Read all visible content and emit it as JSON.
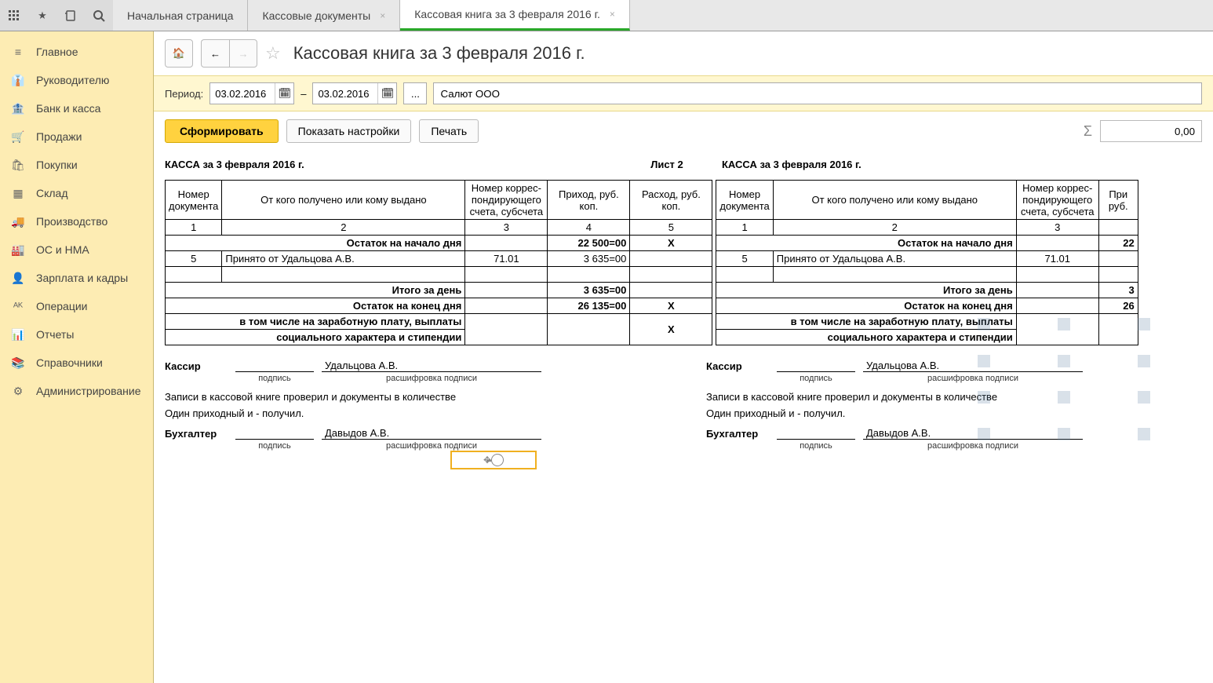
{
  "top": {
    "tabs": [
      {
        "label": "Начальная страница",
        "closable": false,
        "active": false
      },
      {
        "label": "Кассовые документы",
        "closable": true,
        "active": false
      },
      {
        "label": "Кассовая книга за 3 февраля 2016 г.",
        "closable": true,
        "active": true
      }
    ]
  },
  "sidebar": [
    {
      "icon": "menu",
      "label": "Главное"
    },
    {
      "icon": "user-tie",
      "label": "Руководителю"
    },
    {
      "icon": "bank",
      "label": "Банк и касса"
    },
    {
      "icon": "cart",
      "label": "Продажи"
    },
    {
      "icon": "bag",
      "label": "Покупки"
    },
    {
      "icon": "grid",
      "label": "Склад"
    },
    {
      "icon": "truck",
      "label": "Производство"
    },
    {
      "icon": "box",
      "label": "ОС и НМА"
    },
    {
      "icon": "person",
      "label": "Зарплата и кадры"
    },
    {
      "icon": "ops",
      "label": "Операции"
    },
    {
      "icon": "chart",
      "label": "Отчеты"
    },
    {
      "icon": "book",
      "label": "Справочники"
    },
    {
      "icon": "gear",
      "label": "Администрирование"
    }
  ],
  "header": {
    "title": "Кассовая книга за 3 февраля 2016 г."
  },
  "params": {
    "period_label": "Период:",
    "date_from": "03.02.2016",
    "date_sep": "–",
    "date_to": "03.02.2016",
    "dots": "...",
    "org": "Салют ООО"
  },
  "actions": {
    "generate": "Сформировать",
    "settings": "Показать настройки",
    "print": "Печать",
    "sum": "0,00"
  },
  "report": {
    "left_caption": "КАССА за 3 февраля 2016 г.",
    "sheet": "Лист 2",
    "right_caption": "КАССА за 3 февраля 2016 г.",
    "cols": {
      "c1": "Номер документа",
      "c2": "От кого получено или кому выдано",
      "c3": "Номер коррес-пондирующего счета, субсчета",
      "c4": "Приход, руб. коп.",
      "c5": "Расход, руб. коп.",
      "c4p": "При руб."
    },
    "nums": {
      "n1": "1",
      "n2": "2",
      "n3": "3",
      "n4": "4",
      "n5": "5"
    },
    "rows": {
      "open_label": "Остаток на начало дня",
      "open_in": "22 500=00",
      "open_out": "X",
      "row1_num": "5",
      "row1_desc": "Принято от Удальцова А.В.",
      "row1_acct": "71.01",
      "row1_in": "3 635=00",
      "total_label": "Итого за день",
      "total_in": "3 635=00",
      "close_label": "Остаток на конец дня",
      "close_in": "26 135=00",
      "close_out": "X",
      "salary_label1": "в том числе на заработную плату, выплаты",
      "salary_label2": "социального характера и стипендии",
      "salary_out": "X"
    },
    "right_rows": {
      "open_in": "22",
      "total_in": "3",
      "close_in": "26"
    },
    "sig": {
      "cashier_label": "Кассир",
      "cashier_name": "Удальцова А.В.",
      "signature": "подпись",
      "decrypt": "расшифровка подписи",
      "text1": "Записи в кассовой книге проверил и документы в количестве",
      "text2": "Один приходный и  -  получил.",
      "accountant_label": "Бухгалтер",
      "accountant_name": "Давыдов А.В."
    }
  }
}
